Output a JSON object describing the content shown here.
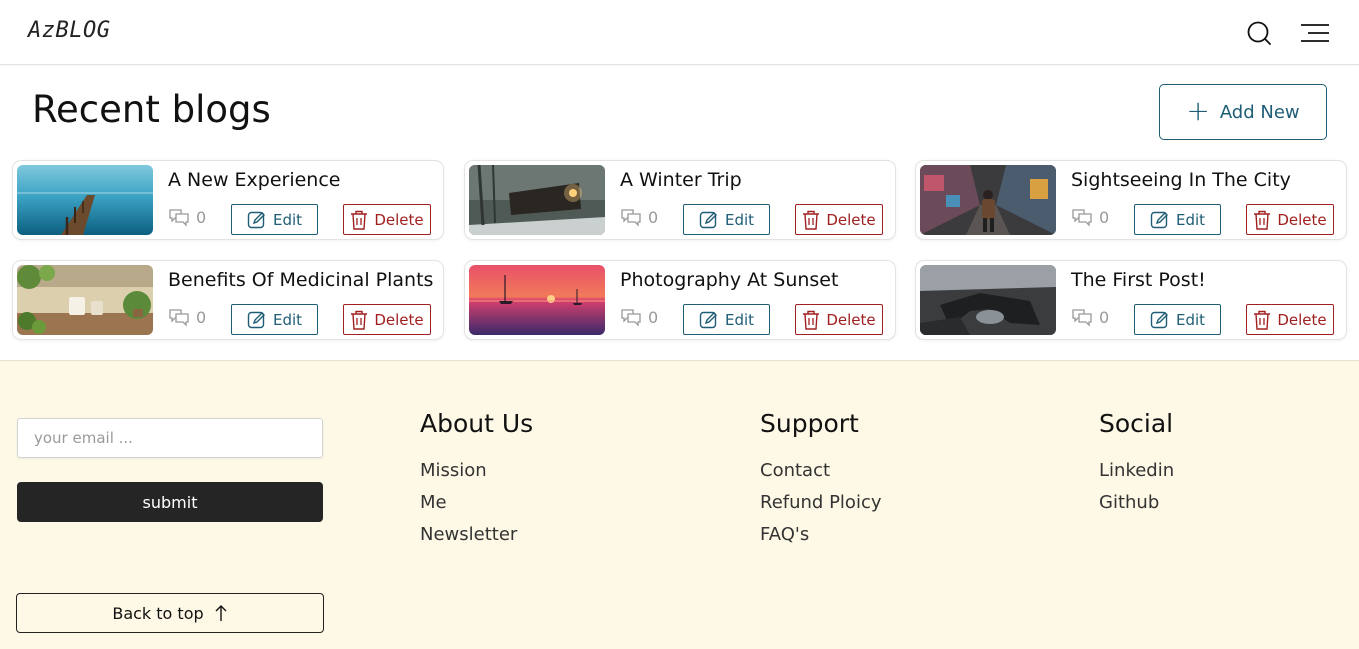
{
  "header": {
    "logo": "AzBLOG",
    "search_icon": "search-icon",
    "menu_icon": "menu-icon"
  },
  "main": {
    "title": "Recent blogs",
    "add_new_label": "Add New",
    "blogs": [
      {
        "title": "A New Experience",
        "comments": "0",
        "edit_label": "Edit",
        "delete_label": "Delete",
        "image": "pier-lake-image"
      },
      {
        "title": "A Winter Trip",
        "comments": "0",
        "edit_label": "Edit",
        "delete_label": "Delete",
        "image": "snowy-train-image"
      },
      {
        "title": "Sightseeing In The City",
        "comments": "0",
        "edit_label": "Edit",
        "delete_label": "Delete",
        "image": "graffiti-alley-image"
      },
      {
        "title": "Benefits Of Medicinal Plants",
        "comments": "0",
        "edit_label": "Edit",
        "delete_label": "Delete",
        "image": "plants-table-image"
      },
      {
        "title": "Photography At Sunset",
        "comments": "0",
        "edit_label": "Edit",
        "delete_label": "Delete",
        "image": "sunset-boats-image"
      },
      {
        "title": "The First Post!",
        "comments": "0",
        "edit_label": "Edit",
        "delete_label": "Delete",
        "image": "rock-arch-image"
      }
    ]
  },
  "footer": {
    "email_placeholder": "your email ...",
    "submit_label": "submit",
    "back_to_top_label": "Back to top",
    "columns": [
      {
        "title": "About Us",
        "links": [
          "Mission",
          "Me",
          "Newsletter"
        ]
      },
      {
        "title": "Support",
        "links": [
          "Contact",
          "Refund Ploicy",
          "FAQ's"
        ]
      },
      {
        "title": "Social",
        "links": [
          "Linkedin",
          "Github"
        ]
      }
    ]
  },
  "colors": {
    "accent": "#1e5d75",
    "danger": "#a02020",
    "footer_bg": "#fdf9e6",
    "submit_bg": "#252525"
  }
}
